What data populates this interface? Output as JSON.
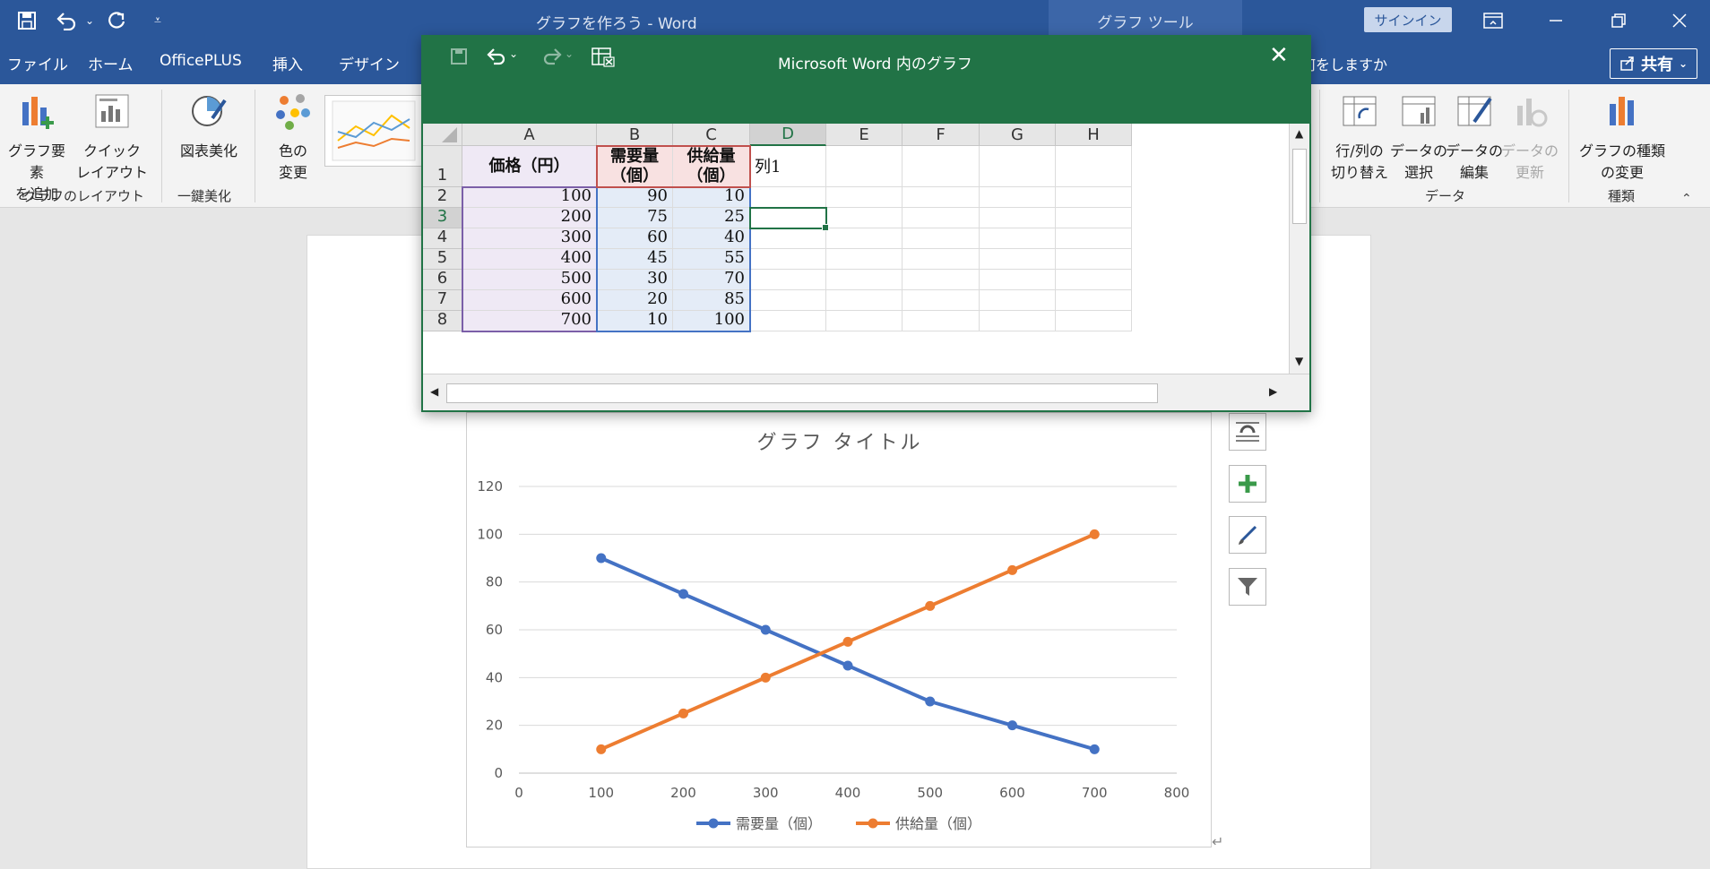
{
  "titlebar": {
    "doc_title": "グラフを作ろう  -  Word",
    "context_tab": "グラフ ツール",
    "signin": "サインイン"
  },
  "menu": {
    "tabs": [
      "ファイル",
      "ホーム",
      "OfficePLUS",
      "挿入",
      "デザイン"
    ],
    "tell_me": "何をしますか",
    "share": "共有"
  },
  "ribbon": {
    "add_element": "グラフ要素\nを追加",
    "quick_layout": "クイック\nレイアウト",
    "group_layout": "グラフのレイアウト",
    "beautify": "図表美化",
    "group_beautify": "一鍵美化",
    "change_colors": "色の\n変更",
    "switch_row_col": "行/列の\n切り替え",
    "select_data": "データの\n選択",
    "edit_data": "データの\n編集",
    "refresh_data": "データの\n更新",
    "group_data": "データ",
    "change_type": "グラフの種類\nの変更",
    "group_type": "種類"
  },
  "excel": {
    "title": "Microsoft Word 内のグラフ",
    "columns": [
      "A",
      "B",
      "C",
      "D",
      "E",
      "F",
      "G",
      "H"
    ],
    "rows": [
      "1",
      "2",
      "3",
      "4",
      "5",
      "6",
      "7",
      "8"
    ],
    "header": [
      "価格（円）",
      "需要量（個）",
      "供給量（個）",
      "列1"
    ],
    "data": [
      [
        "100",
        "90",
        "10"
      ],
      [
        "200",
        "75",
        "25"
      ],
      [
        "300",
        "60",
        "40"
      ],
      [
        "400",
        "45",
        "55"
      ],
      [
        "500",
        "30",
        "70"
      ],
      [
        "600",
        "20",
        "85"
      ],
      [
        "700",
        "10",
        "100"
      ]
    ]
  },
  "colors": {
    "word_blue": "#2b579a",
    "excel_green": "#217346",
    "series_demand": "#4472c4",
    "series_supply": "#ed7d31"
  },
  "chart_data": {
    "type": "scatter",
    "title": "グラフ タイトル",
    "xlim": [
      0,
      800
    ],
    "ylim": [
      0,
      120
    ],
    "x_ticks": [
      0,
      100,
      200,
      300,
      400,
      500,
      600,
      700,
      800
    ],
    "y_ticks": [
      0,
      20,
      40,
      60,
      80,
      100,
      120
    ],
    "grid": true,
    "legend_position": "bottom",
    "x": [
      100,
      200,
      300,
      400,
      500,
      600,
      700
    ],
    "series": [
      {
        "name": "需要量（個）",
        "values": [
          90,
          75,
          60,
          45,
          30,
          20,
          10
        ]
      },
      {
        "name": "供給量（個）",
        "values": [
          10,
          25,
          40,
          55,
          70,
          85,
          100
        ]
      }
    ]
  }
}
